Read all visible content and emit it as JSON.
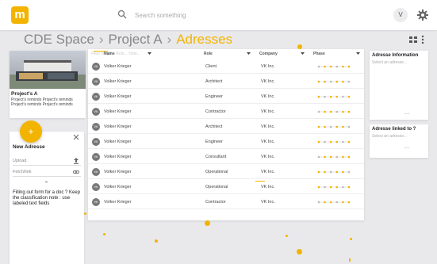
{
  "header": {
    "search_placeholder": "Search something",
    "avatar_initial": "V"
  },
  "breadcrumb": {
    "root": "CDE Space",
    "project": "Project A",
    "current": "Adresses",
    "separator": "›"
  },
  "project_card": {
    "title": "Project's A",
    "description": "Project's reminds Project's reminds Project's reminds Project's reminds"
  },
  "add_button": {
    "label": "+"
  },
  "new_adresse": {
    "title": "New Adresse",
    "fields": [
      "Upload",
      "Fetch/link"
    ],
    "note": "Filling out form for a doc ? Keep the classification note : use labeled text fields"
  },
  "table": {
    "filter_placeholder": "Filter Name... Role... Note...",
    "columns": [
      "Name",
      "Role",
      "Company",
      "Phase"
    ],
    "rows": [
      {
        "initials": "VK",
        "name": "Volker Krieger",
        "role": "Client",
        "company": "VK Inc."
      },
      {
        "initials": "VK",
        "name": "Volker Krieger",
        "role": "Architect",
        "company": "VK Inc."
      },
      {
        "initials": "VK",
        "name": "Volker Krieger",
        "role": "Engineer",
        "company": "VK Inc."
      },
      {
        "initials": "VK",
        "name": "Volker Krieger",
        "role": "Contractor",
        "company": "VK Inc."
      },
      {
        "initials": "VK",
        "name": "Volker Krieger",
        "role": "Architect",
        "company": "VK Inc."
      },
      {
        "initials": "VK",
        "name": "Volker Krieger",
        "role": "Engineer",
        "company": "VK Inc."
      },
      {
        "initials": "VK",
        "name": "Volker Krieger",
        "role": "Consultant",
        "company": "VK Inc."
      },
      {
        "initials": "VK",
        "name": "Volker Krieger",
        "role": "Operational",
        "company": "VK Inc."
      },
      {
        "initials": "VK",
        "name": "Volker Krieger",
        "role": "Operational",
        "company": "VK Inc."
      },
      {
        "initials": "VK",
        "name": "Volker Krieger",
        "role": "Contractor",
        "company": "VK Inc."
      }
    ]
  },
  "info_panel": {
    "title": "Adresse Information",
    "placeholder": "Select an adresse...",
    "dots": "..."
  },
  "linked_panel": {
    "title": "Adresse linked to ?",
    "placeholder": "Select an adresse...",
    "dots": "..."
  },
  "colors": {
    "accent": "#f2b400",
    "background": "#e9e9ec"
  },
  "icons": [
    "search-icon",
    "gear-icon",
    "close-icon",
    "upload-icon",
    "link-icon",
    "view-icon",
    "more-icon"
  ]
}
